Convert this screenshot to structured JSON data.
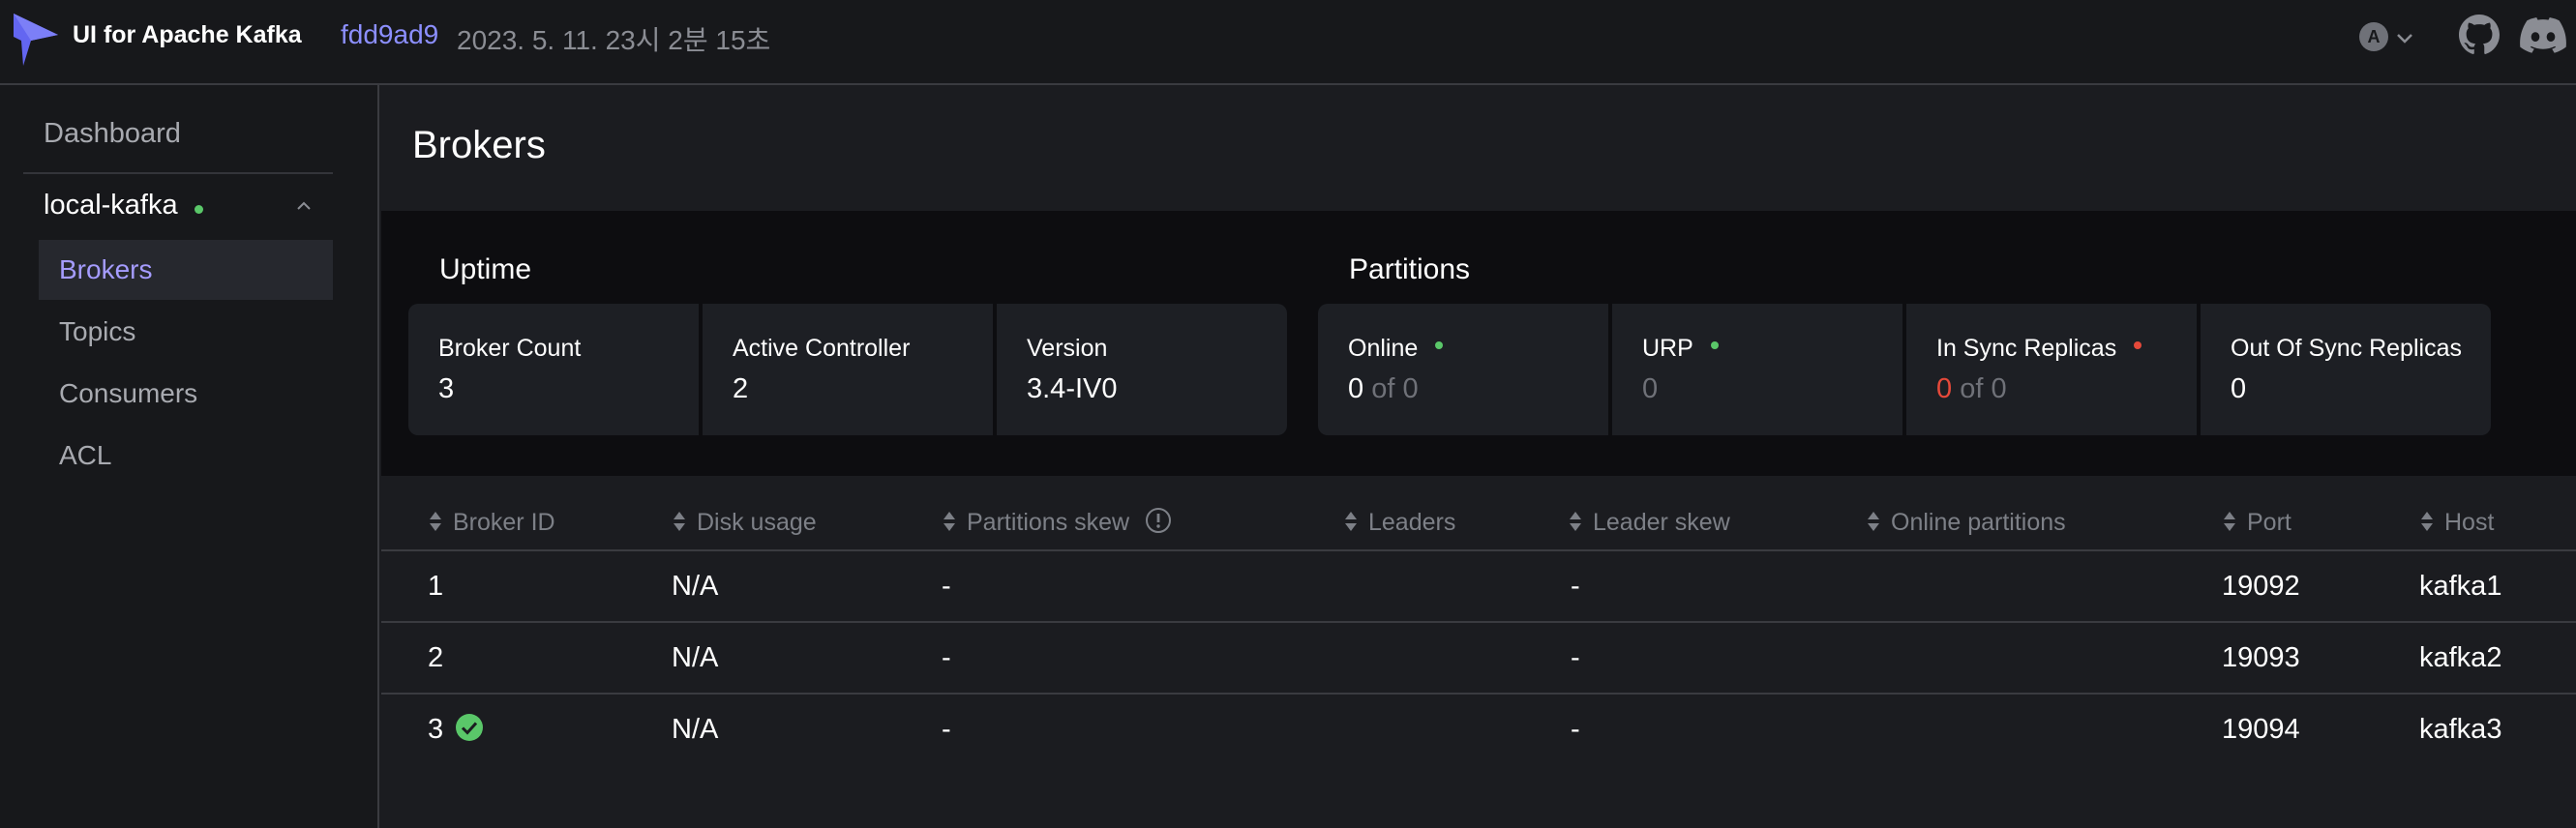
{
  "header": {
    "app_title": "UI for Apache Kafka",
    "commit": "fdd9ad9",
    "build_date": "2023. 5. 11. 23시 2분 15초",
    "lang": "A"
  },
  "sidebar": {
    "dashboard": "Dashboard",
    "cluster": {
      "name": "local-kafka",
      "status_color": "#5ac769"
    },
    "items": [
      {
        "label": "Brokers",
        "active": true
      },
      {
        "label": "Topics",
        "active": false
      },
      {
        "label": "Consumers",
        "active": false
      },
      {
        "label": "ACL",
        "active": false
      }
    ]
  },
  "main": {
    "title": "Brokers",
    "uptime": {
      "title": "Uptime",
      "cards": [
        {
          "label": "Broker Count",
          "value": "3"
        },
        {
          "label": "Active Controller",
          "value": "2"
        },
        {
          "label": "Version",
          "value": "3.4-IV0"
        }
      ]
    },
    "partitions": {
      "title": "Partitions",
      "online": {
        "label": "Online",
        "value": "0",
        "of": "of 0"
      },
      "urp": {
        "label": "URP",
        "value": "0"
      },
      "in_sync": {
        "label": "In Sync Replicas",
        "value": "0",
        "of": "of 0"
      },
      "out_of_sync": {
        "label": "Out Of Sync Replicas",
        "value": "0"
      }
    },
    "table": {
      "headers": [
        "Broker ID",
        "Disk usage",
        "Partitions skew",
        "Leaders",
        "Leader skew",
        "Online partitions",
        "Port",
        "Host"
      ],
      "rows": [
        {
          "id": "1",
          "disk": "N/A",
          "partitions_skew": "-",
          "leaders": "",
          "leader_skew": "-",
          "online_partitions": "",
          "port": "19092",
          "host": "kafka1",
          "controller": false
        },
        {
          "id": "2",
          "disk": "N/A",
          "partitions_skew": "-",
          "leaders": "",
          "leader_skew": "-",
          "online_partitions": "",
          "port": "19093",
          "host": "kafka2",
          "controller": false
        },
        {
          "id": "3",
          "disk": "N/A",
          "partitions_skew": "-",
          "leaders": "",
          "leader_skew": "-",
          "online_partitions": "",
          "port": "19094",
          "host": "kafka3",
          "controller": true
        }
      ]
    }
  },
  "colors": {
    "accent": "#8c8fff",
    "online_dot": "#5ac769",
    "alert_dot": "#e5493a",
    "controller_check": "#5ac769"
  }
}
